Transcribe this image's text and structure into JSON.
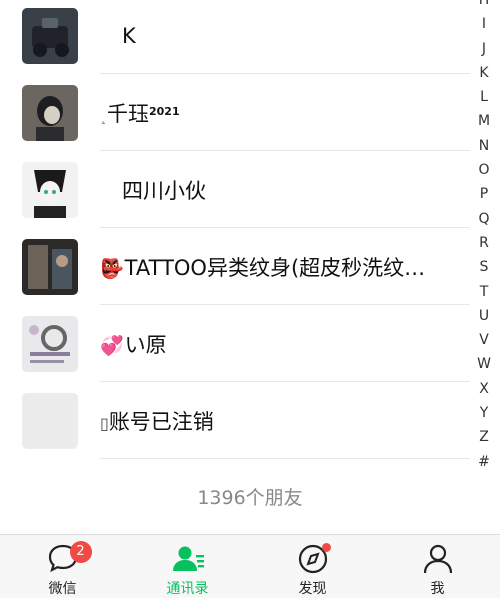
{
  "contacts": [
    {
      "name": "K"
    },
    {
      "name": "千珏",
      "prefix": "˛",
      "suffix": "2021"
    },
    {
      "name": "四川小伙"
    },
    {
      "name": "TATTOO异类纹身(超皮秒洗纹…",
      "emoji": "👺"
    },
    {
      "name": "い原",
      "emoji": "💞"
    },
    {
      "name": "账号已注销",
      "prefix": "▯"
    }
  ],
  "index_letters": [
    "H",
    "I",
    "J",
    "K",
    "L",
    "M",
    "N",
    "O",
    "P",
    "Q",
    "R",
    "S",
    "T",
    "U",
    "V",
    "W",
    "X",
    "Y",
    "Z",
    "#"
  ],
  "friend_count": "1396个朋友",
  "tabs": [
    {
      "label": "微信",
      "badge": "2"
    },
    {
      "label": "通讯录"
    },
    {
      "label": "发现"
    },
    {
      "label": "我"
    }
  ],
  "colors": {
    "accent": "#07c160",
    "badge": "#f04a44"
  }
}
